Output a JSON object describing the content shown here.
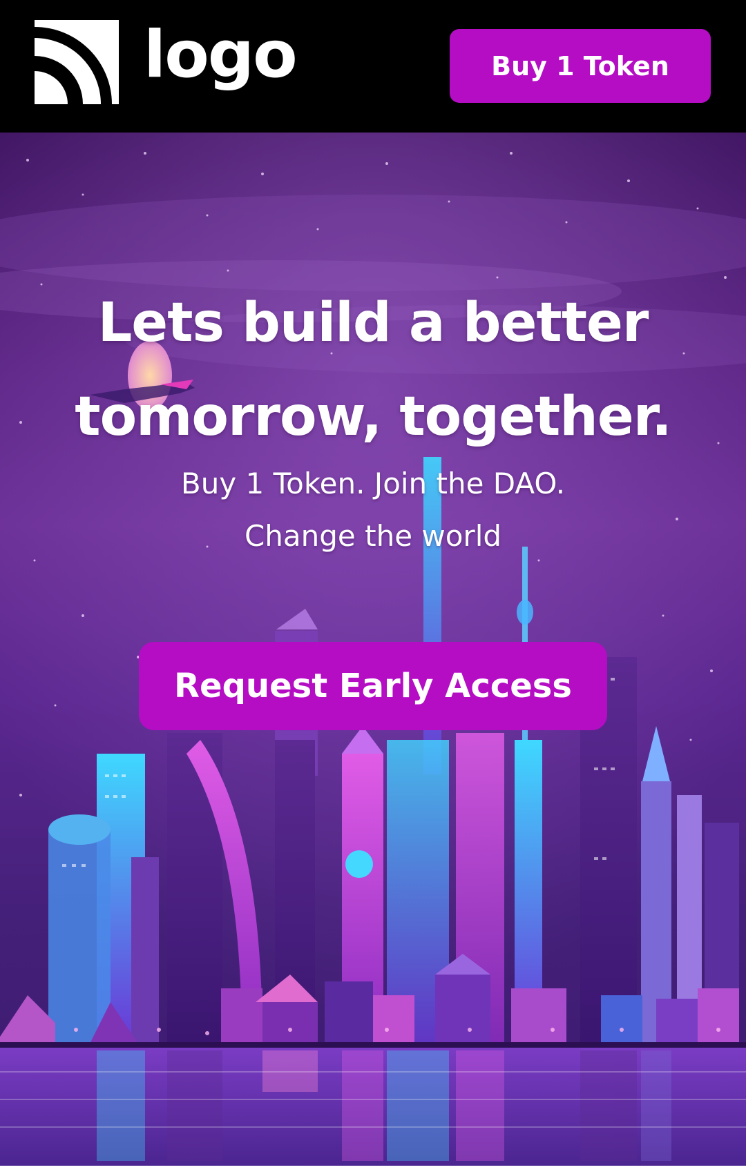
{
  "header": {
    "logo_text": "logo",
    "logo_icon": "rss-feed-icon",
    "buy_button_label": "Buy 1 Token"
  },
  "hero": {
    "headline_line1": "Lets build a better",
    "headline_line2": "tomorrow, together.",
    "subhead_line1": "Buy 1 Token. Join the DAO.",
    "subhead_line2": "Change the world",
    "cta_label": "Request Early Access",
    "background": "night-city-skyline-illustration"
  },
  "colors": {
    "accent": "#b40dc4",
    "header_bg": "#000000",
    "text": "#ffffff",
    "sky_dark": "#3e1460",
    "sky_mid": "#6a2f96"
  }
}
